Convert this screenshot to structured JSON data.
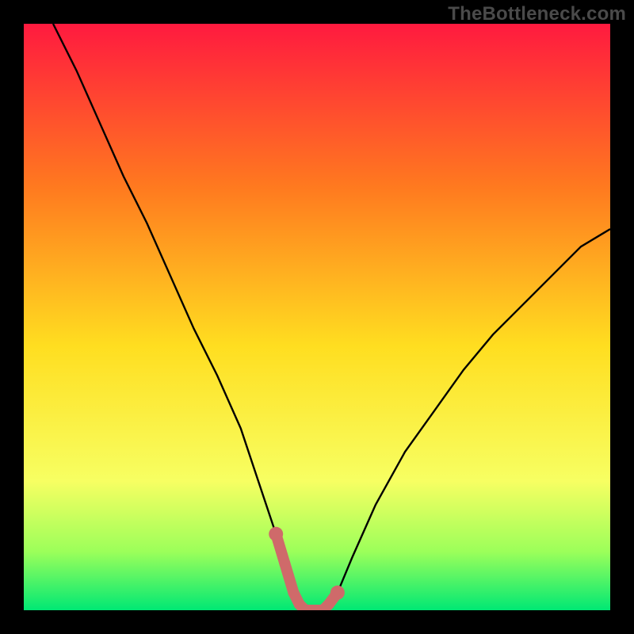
{
  "watermark": "TheBottleneck.com",
  "colors": {
    "frame_black": "#000000",
    "curve_black": "#000000",
    "marker_muted_red": "#cf6a6a",
    "gradient_top": "#ff1a3f",
    "gradient_mid_upper": "#ff7a1f",
    "gradient_mid": "#ffde20",
    "gradient_mid_lower": "#f7ff62",
    "gradient_lower": "#9cff5a",
    "gradient_bottom": "#00e874"
  },
  "chart_data": {
    "type": "line",
    "title": "",
    "xlabel": "",
    "ylabel": "",
    "xlim": [
      0,
      100
    ],
    "ylim": [
      0,
      100
    ],
    "series": [
      {
        "name": "bottleneck-curve",
        "x": [
          5,
          9,
          13,
          17,
          21,
          25,
          29,
          33,
          37,
          40,
          43,
          44.5,
          46,
          47,
          48,
          49,
          50,
          51,
          52,
          53.5,
          56,
          60,
          65,
          70,
          75,
          80,
          85,
          90,
          95,
          100
        ],
        "y": [
          100,
          92,
          83,
          74,
          66,
          57,
          48,
          40,
          31,
          22,
          13,
          8,
          3,
          1,
          0,
          0,
          0,
          0,
          1,
          3,
          9,
          18,
          27,
          34,
          41,
          47,
          52,
          57,
          62,
          65
        ]
      }
    ],
    "flat_marker": {
      "name": "optimal-zone",
      "x": [
        43,
        44.5,
        46,
        47,
        48,
        49,
        50,
        51,
        52,
        53.5
      ],
      "y": [
        13,
        8,
        3,
        1,
        0,
        0,
        0,
        0,
        1,
        3
      ]
    },
    "background_gradient": {
      "stops": [
        {
          "offset": 0.0,
          "color": "#ff1a3f"
        },
        {
          "offset": 0.28,
          "color": "#ff7a1f"
        },
        {
          "offset": 0.55,
          "color": "#ffde20"
        },
        {
          "offset": 0.78,
          "color": "#f7ff62"
        },
        {
          "offset": 0.9,
          "color": "#9cff5a"
        },
        {
          "offset": 1.0,
          "color": "#00e874"
        }
      ]
    }
  }
}
